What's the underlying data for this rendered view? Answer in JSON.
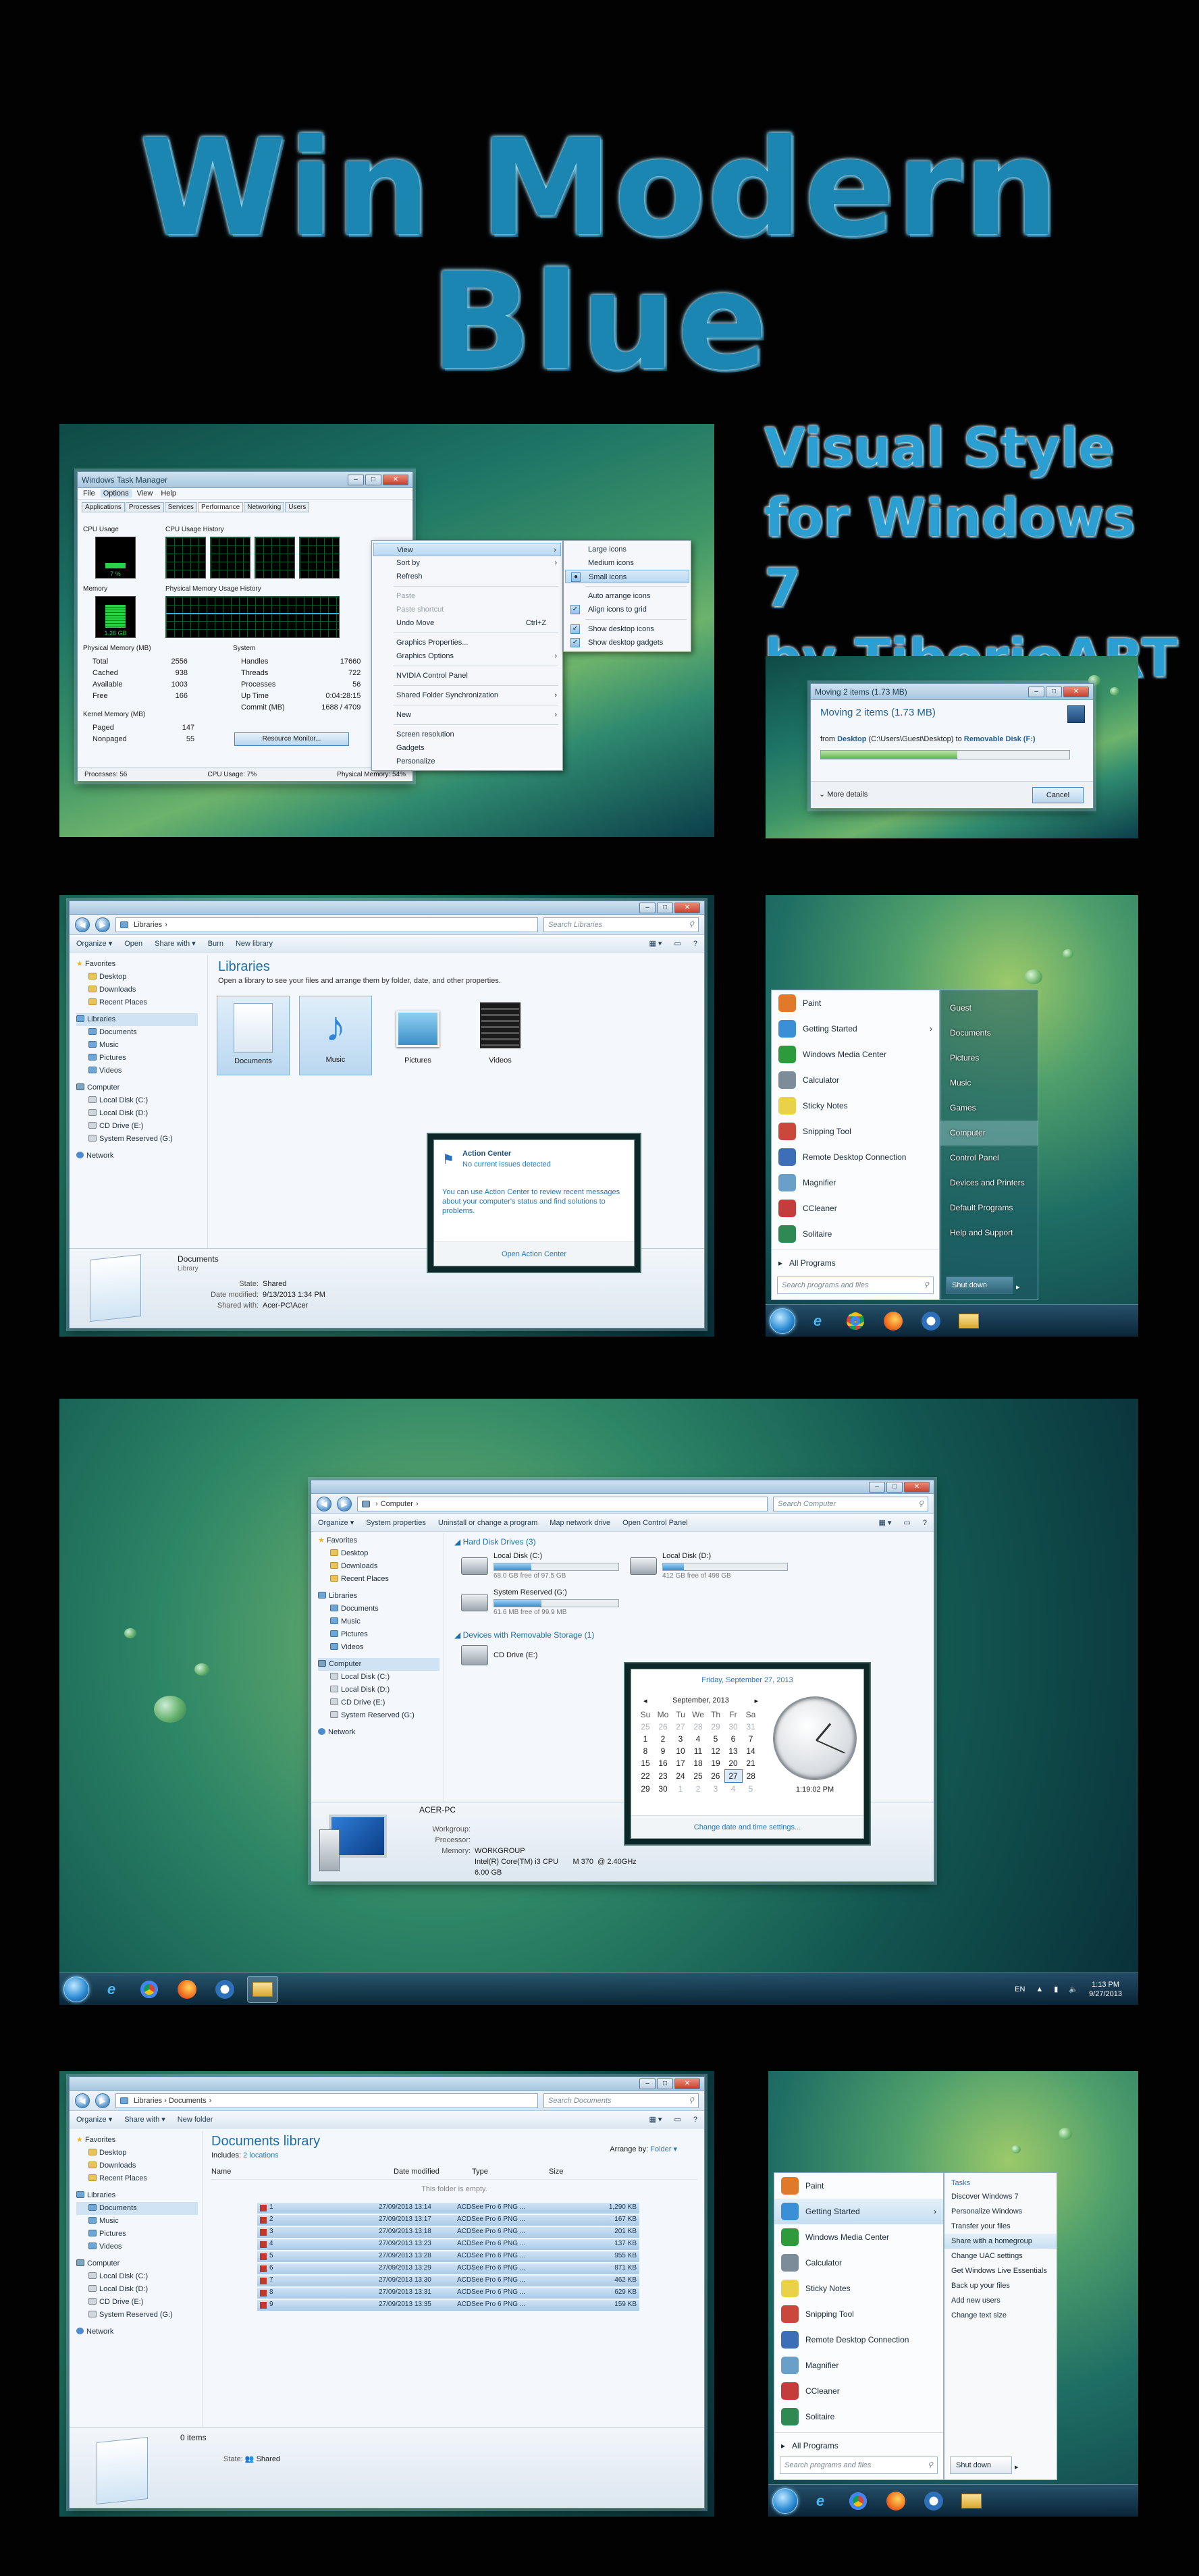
{
  "header": {
    "title": "Win Modern Blue",
    "subtitle_lines": [
      "Visual Style",
      "for Windows 7",
      "by TiborioART"
    ]
  },
  "task_manager": {
    "title": "Windows Task Manager",
    "menu": [
      "File",
      "Options",
      "View",
      "Help"
    ],
    "tabs": [
      "Applications",
      "Processes",
      "Services",
      "Performance",
      "Networking",
      "Users"
    ],
    "labels": {
      "cpu_usage": "CPU Usage",
      "cpu_history": "CPU Usage History",
      "memory": "Memory",
      "phys_history": "Physical Memory Usage History",
      "phys_mem": "Physical Memory (MB)",
      "system": "System",
      "kernel": "Kernel Memory (MB)"
    },
    "cpu_value": "7 %",
    "mem_value": "1.26 GB",
    "phys": [
      [
        "Total",
        "2556"
      ],
      [
        "Cached",
        "938"
      ],
      [
        "Available",
        "1003"
      ],
      [
        "Free",
        "166"
      ]
    ],
    "sys": [
      [
        "Handles",
        "17660"
      ],
      [
        "Threads",
        "722"
      ],
      [
        "Processes",
        "56"
      ],
      [
        "Up Time",
        "0:04:28:15"
      ],
      [
        "Commit (MB)",
        "1688 / 4709"
      ]
    ],
    "kernel": [
      [
        "Paged",
        "147"
      ],
      [
        "Nonpaged",
        "55"
      ]
    ],
    "resource_btn": "Resource Monitor...",
    "status": [
      "Processes: 56",
      "CPU Usage: 7%",
      "Physical Memory: 54%"
    ]
  },
  "context_menu": {
    "items": [
      {
        "label": "View",
        "arrow": "›"
      },
      {
        "label": "Sort by",
        "arrow": "›"
      },
      {
        "label": "Refresh"
      },
      {
        "sep": true
      },
      {
        "label": "Paste",
        "dis": true
      },
      {
        "label": "Paste shortcut",
        "dis": true
      },
      {
        "label": "Undo Move",
        "key": "Ctrl+Z"
      },
      {
        "sep": true
      },
      {
        "label": "Graphics Properties..."
      },
      {
        "label": "Graphics Options",
        "arrow": "›"
      },
      {
        "sep": true
      },
      {
        "label": "NVIDIA Control Panel"
      },
      {
        "sep": true
      },
      {
        "label": "Shared Folder Synchronization",
        "arrow": "›"
      },
      {
        "sep": true
      },
      {
        "label": "New",
        "arrow": "›"
      },
      {
        "sep": true
      },
      {
        "label": "Screen resolution"
      },
      {
        "label": "Gadgets"
      },
      {
        "label": "Personalize"
      }
    ],
    "submenu": [
      {
        "label": "Large icons"
      },
      {
        "label": "Medium icons"
      },
      {
        "label": "Small icons",
        "chk": "●"
      },
      {
        "sep": true
      },
      {
        "label": "Auto arrange icons"
      },
      {
        "label": "Align icons to grid",
        "chk": "✓"
      },
      {
        "sep": true
      },
      {
        "label": "Show desktop icons",
        "chk": "✓"
      },
      {
        "label": "Show desktop gadgets",
        "chk": "✓"
      }
    ]
  },
  "copy_dialog": {
    "title": "Moving 2 items (1.73 MB)",
    "heading": "Moving 2 items (1.73 MB)",
    "from_label": "from",
    "from": "Desktop",
    "path": "(C:\\Users\\Guest\\Desktop)",
    "to_label": "to",
    "to": "Removable Disk (F:)",
    "more": "More details",
    "cancel": "Cancel",
    "progress": 0.55
  },
  "libraries": {
    "address": "Libraries",
    "search": "Search Libraries",
    "cmd": [
      "Organize ▾",
      "Open",
      "Share with ▾",
      "Burn",
      "New library"
    ],
    "heading": "Libraries",
    "desc": "Open a library to see your files and arrange them by folder, date, and other properties.",
    "items": [
      "Documents",
      "Music",
      "Pictures",
      "Videos"
    ],
    "details_name": "Documents",
    "details_type": "Library",
    "details": [
      [
        "State:",
        "Shared"
      ],
      [
        "Date modified:",
        "9/13/2013 1:34 PM"
      ],
      [
        "Shared with:",
        "Acer-PC\\Acer"
      ]
    ]
  },
  "nav_pane": {
    "favorites": "Favorites",
    "fav_items": [
      "Desktop",
      "Downloads",
      "Recent Places"
    ],
    "libraries": "Libraries",
    "lib_items": [
      "Documents",
      "Music",
      "Pictures",
      "Videos"
    ],
    "computer": "Computer",
    "comp_items": [
      "Local Disk (C:)",
      "Local Disk (D:)",
      "CD Drive (E:)",
      "System Reserved (G:)"
    ],
    "network": "Network"
  },
  "action_center": {
    "title": "Action Center",
    "subtitle": "No current issues detected",
    "body": "You can use Action Center to review recent messages about your computer's status and find solutions to problems.",
    "link": "Open Action Center"
  },
  "start_menu_a": {
    "left": [
      "Paint",
      "Getting Started",
      "Windows Media Center",
      "Calculator",
      "Sticky Notes",
      "Snipping Tool",
      "Remote Desktop Connection",
      "Magnifier",
      "CCleaner",
      "Solitaire"
    ],
    "all": "All Programs",
    "search": "Search programs and files",
    "right": [
      "Guest",
      "Documents",
      "Pictures",
      "Music",
      "Games",
      "Computer",
      "Control Panel",
      "Devices and Printers",
      "Default Programs",
      "Help and Support"
    ],
    "shutdown": "Shut down"
  },
  "computer": {
    "address": "Computer",
    "search": "Search Computer",
    "cmd": [
      "Organize ▾",
      "System properties",
      "Uninstall or change a program",
      "Map network drive",
      "Open Control Panel"
    ],
    "hdd_group": "Hard Disk Drives (3)",
    "drives": [
      {
        "name": "Local Disk (C:)",
        "free": "68.0 GB free of 97.5 GB",
        "fill": 0.3
      },
      {
        "name": "Local Disk (D:)",
        "free": "412 GB free of 498 GB",
        "fill": 0.17
      },
      {
        "name": "System Reserved (G:)",
        "free": "61.6 MB free of 99.9 MB",
        "fill": 0.38
      }
    ],
    "removable_group": "Devices with Removable Storage (1)",
    "cd": "CD Drive (E:)",
    "pc_name": "ACER-PC",
    "info": [
      [
        "Workgroup:",
        "WORKGROUP"
      ],
      [
        "Processor:",
        "Intel(R) Core(TM) i3 CPU       M 370  @ 2.40GHz"
      ],
      [
        "Memory:",
        "6.00 GB"
      ]
    ]
  },
  "calendar": {
    "date_long": "Friday, September 27, 2013",
    "month": "September, 2013",
    "days": [
      "Su",
      "Mo",
      "Tu",
      "We",
      "Th",
      "Fr",
      "Sa"
    ],
    "weeks": [
      [
        "25",
        "26",
        "27",
        "28",
        "29",
        "30",
        "31"
      ],
      [
        "1",
        "2",
        "3",
        "4",
        "5",
        "6",
        "7"
      ],
      [
        "8",
        "9",
        "10",
        "11",
        "12",
        "13",
        "14"
      ],
      [
        "15",
        "16",
        "17",
        "18",
        "19",
        "20",
        "21"
      ],
      [
        "22",
        "23",
        "24",
        "25",
        "26",
        "27",
        "28"
      ],
      [
        "29",
        "30",
        "1",
        "2",
        "3",
        "4",
        "5"
      ]
    ],
    "time": "1:19:02 PM",
    "link": "Change date and time settings..."
  },
  "tray": {
    "lang": "EN",
    "time": "1:13 PM",
    "date": "9/27/2013"
  },
  "docs_library": {
    "address": "Libraries › Documents",
    "search": "Search Documents",
    "cmd": [
      "Organize ▾",
      "Share with ▾",
      "New folder"
    ],
    "heading": "Documents library",
    "includes": "Includes:",
    "locations": "2 locations",
    "arrange": "Arrange by:",
    "arrange_val": "Folder ▾",
    "cols": [
      "Name",
      "Date modified",
      "Type",
      "Size"
    ],
    "empty": "This folder is empty.",
    "rows": [
      [
        "1",
        "27/09/2013 13:14",
        "ACDSee Pro 6 PNG ...",
        "1,290 KB"
      ],
      [
        "2",
        "27/09/2013 13:17",
        "ACDSee Pro 6 PNG ...",
        "167 KB"
      ],
      [
        "3",
        "27/09/2013 13:18",
        "ACDSee Pro 6 PNG ...",
        "201 KB"
      ],
      [
        "4",
        "27/09/2013 13:23",
        "ACDSee Pro 6 PNG ...",
        "137 KB"
      ],
      [
        "5",
        "27/09/2013 13:28",
        "ACDSee Pro 6 PNG ...",
        "955 KB"
      ],
      [
        "6",
        "27/09/2013 13:29",
        "ACDSee Pro 6 PNG ...",
        "871 KB"
      ],
      [
        "7",
        "27/09/2013 13:30",
        "ACDSee Pro 6 PNG ...",
        "462 KB"
      ],
      [
        "8",
        "27/09/2013 13:31",
        "ACDSee Pro 6 PNG ...",
        "629 KB"
      ],
      [
        "9",
        "27/09/2013 13:35",
        "ACDSee Pro 6 PNG ...",
        "159 KB"
      ]
    ],
    "items_count": "0 items",
    "state_label": "State:",
    "state": "Shared"
  },
  "start_menu_b": {
    "left": [
      "Paint",
      "Getting Started",
      "Windows Media Center",
      "Calculator",
      "Sticky Notes",
      "Snipping Tool",
      "Remote Desktop Connection",
      "Magnifier",
      "CCleaner",
      "Solitaire"
    ],
    "all": "All Programs",
    "search": "Search programs and files",
    "tasks_header": "Tasks",
    "tasks": [
      "Discover Windows 7",
      "Personalize Windows",
      "Transfer your files",
      "Share with a homegroup",
      "Change UAC settings",
      "Get Windows Live Essentials",
      "Back up your files",
      "Add new users",
      "Change text size"
    ],
    "shutdown": "Shut down"
  }
}
